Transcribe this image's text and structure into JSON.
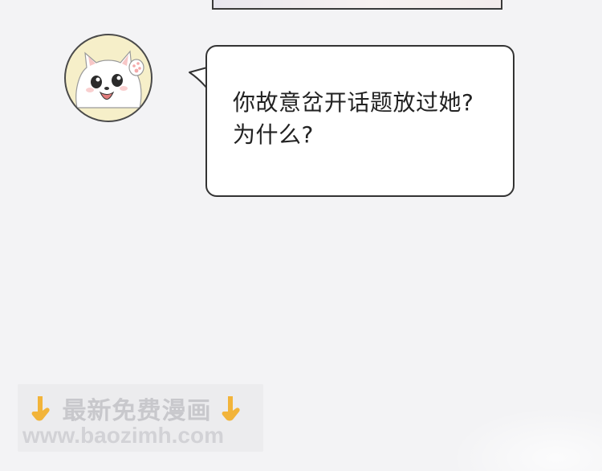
{
  "bubble": {
    "message": "你故意岔开话题放过她?\n为什么?"
  },
  "watermark": {
    "line1": "最新免费漫画",
    "line2": "www.baozimh.com",
    "icon": "pointing-down-hand-icon"
  },
  "colors": {
    "background": "#f3f3f5",
    "bubble_fill": "#ffffff",
    "bubble_border": "#333333",
    "avatar_fill": "#f6efc9",
    "watermark_text": "#c8c8cc",
    "hand_icon": "#f2b43a"
  }
}
